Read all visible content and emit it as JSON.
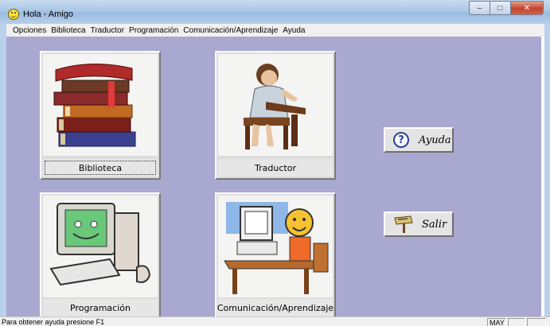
{
  "window": {
    "title": "Hola - Amigo",
    "controls": {
      "minimize": "–",
      "maximize": "□",
      "close": "✕"
    }
  },
  "menu": [
    {
      "label": "Opciones"
    },
    {
      "label": "Biblioteca"
    },
    {
      "label": "Traductor"
    },
    {
      "label": "Programación"
    },
    {
      "label": "Comunicación/Aprendizaje"
    },
    {
      "label": "Ayuda"
    }
  ],
  "tiles": {
    "biblioteca": {
      "label": "Biblioteca",
      "icon": "books-icon"
    },
    "traductor": {
      "label": "Traductor",
      "icon": "child-writing-icon"
    },
    "programacion": {
      "label": "Programación",
      "icon": "smiling-computer-icon"
    },
    "comunicacion": {
      "label": "Comunicación/Aprendizaje",
      "icon": "student-at-computer-icon"
    }
  },
  "buttons": {
    "ayuda": {
      "label": "Ayuda",
      "icon": "question-icon"
    },
    "salir": {
      "label": "Salir",
      "icon": "exit-sign-icon"
    }
  },
  "statusbar": {
    "hint": "Para obtener ayuda presione F1",
    "caps": "MAY"
  },
  "colors": {
    "client_background": "#a8a8d1",
    "tile_face": "#dcdcdc",
    "title_gradient": "#a9c6e6"
  }
}
